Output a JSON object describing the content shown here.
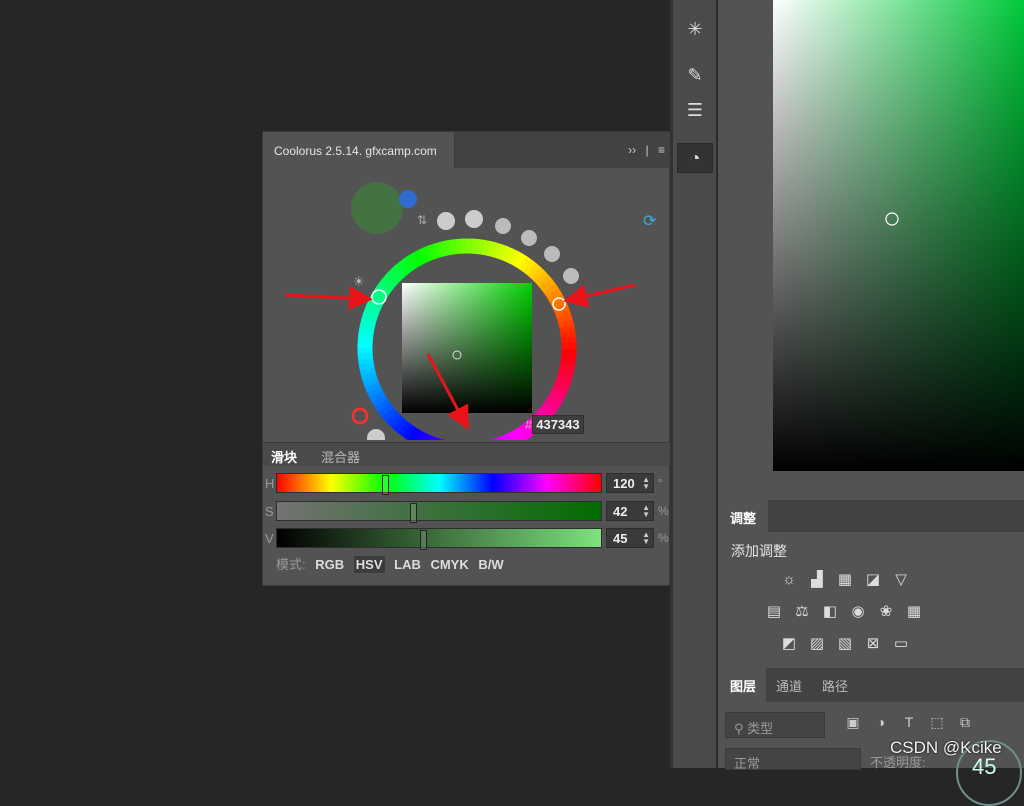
{
  "panel": {
    "tab_title": "Coolorus 2.5.14. gfxcamp.com",
    "expand_glyph": "››",
    "menu_glyph": "≡",
    "hex_prefix": "#",
    "hex_value": "437343",
    "current_color": "#437343",
    "previous_color": "#2f6bd1"
  },
  "subtabs": {
    "sliders": "滑块",
    "mixer": "混合器"
  },
  "sliders": [
    {
      "letter": "H",
      "value": "120",
      "unit": "°",
      "fraction": 0.333
    },
    {
      "letter": "S",
      "value": "42",
      "unit": "%",
      "fraction": 0.42
    },
    {
      "letter": "V",
      "value": "45",
      "unit": "%",
      "fraction": 0.45
    }
  ],
  "modes": {
    "label": "模式:",
    "items": [
      "RGB",
      "HSV",
      "LAB",
      "CMYK",
      "B/W"
    ],
    "active": "HSV"
  },
  "adjustments": {
    "tab": "调整",
    "title": "添加调整"
  },
  "layers": {
    "tabs": [
      "图层",
      "通道",
      "路径"
    ],
    "filter_label": "类型",
    "blend_mode": "正常",
    "opacity_label": "不透明度:"
  },
  "watermark": "CSDN @Kcike",
  "corner_badge": "45",
  "colors": {
    "accent_green": "#00b52a",
    "arrow_red": "#e8141a"
  }
}
